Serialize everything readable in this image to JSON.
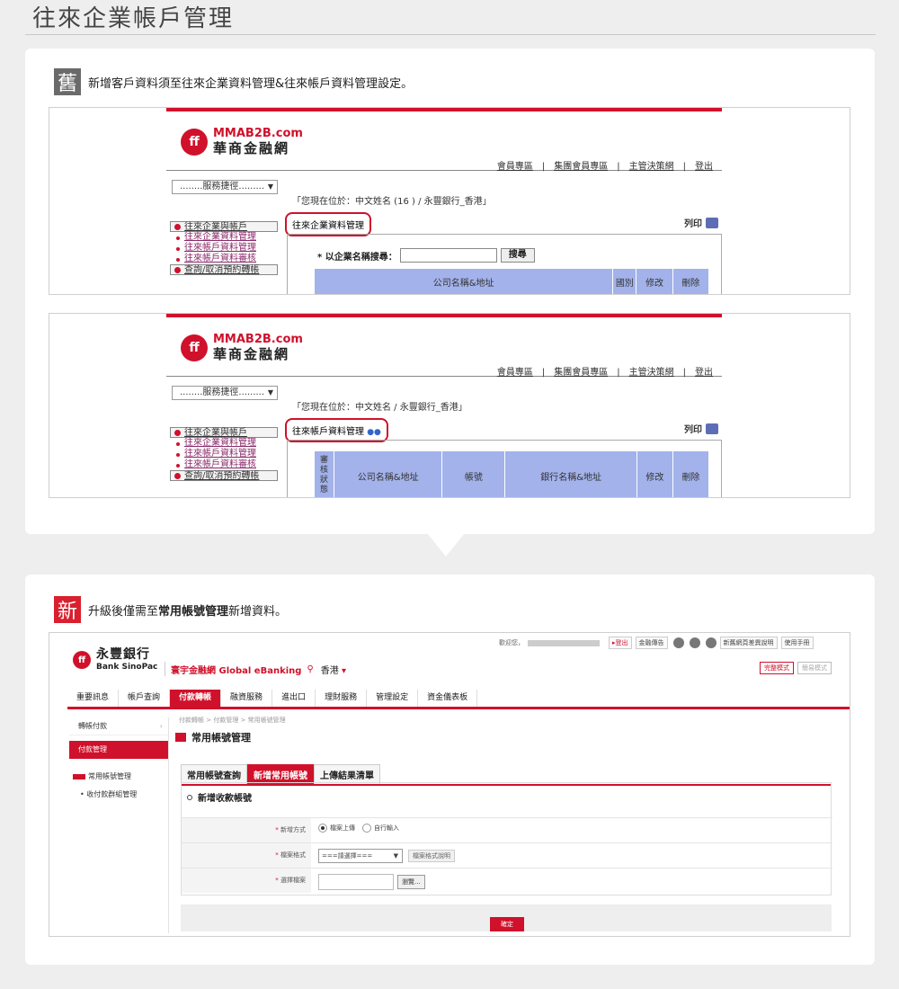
{
  "page_title": "往來企業帳戶管理",
  "old": {
    "badge": "舊",
    "note": "新增客戶資料須至往來企業資料管理&往來帳戶資料管理設定。",
    "brand_en": "MMAB2B.com",
    "brand_zh": "華商金融網",
    "logo_glyph": "ff",
    "top_links": [
      "會員專區",
      "集團會員專區",
      "主管決策網",
      "登出"
    ],
    "service_select": "........服務捷徑.........",
    "side_head1": "往來企業與帳戶",
    "side_items": [
      "往來企業資料管理",
      "往來帳戶資料管理",
      "往來帳戶資料審核"
    ],
    "side_head2": "查詢/取消預約轉帳",
    "print_label": "列印",
    "shot1": {
      "location": "「您現在位於：中文姓名 (16        ) / 永豐銀行_香港」",
      "section_title": "往來企業資料管理",
      "search_label": "* 以企業名稱搜尋：",
      "search_button": "搜尋",
      "columns": [
        "公司名稱&地址",
        "國別",
        "修改",
        "刪除"
      ]
    },
    "shot2": {
      "location": "「您現在位於：中文姓名            / 永豐銀行_香港」",
      "section_title": "往來帳戶資料管理",
      "columns": [
        "審核狀態",
        "公司名稱&地址",
        "帳號",
        "銀行名稱&地址",
        "修改",
        "刪除"
      ]
    }
  },
  "new": {
    "badge": "新",
    "note_prefix": "升級後僅需至",
    "note_bold": "常用帳號管理",
    "note_suffix": "新增資料。",
    "welcome": "歡迎您，",
    "top_links": [
      "▸登出",
      "金融傳告",
      "新舊網頁差異說明",
      "使用手冊"
    ],
    "bank_zh": "永豐銀行",
    "bank_en": "Bank SinoPac",
    "logo_glyph": "ff",
    "ebank": "寰宇金融網 Global eBanking",
    "region": "香港",
    "modes": [
      "完整模式",
      "簡易模式"
    ],
    "nav": [
      "重要訊息",
      "帳戶查詢",
      "付款轉帳",
      "融資服務",
      "進出口",
      "理財服務",
      "管理設定",
      "資金儀表板"
    ],
    "left_menu": [
      "轉帳付款",
      "付款管理",
      "常用帳號管理",
      "收付款群組管理"
    ],
    "breadcrumb": "付款轉帳 > 付款管理 > 常用帳號管理",
    "page_title": "常用帳號管理",
    "tabs": [
      "常用帳號查詢",
      "新增常用帳號",
      "上傳結果清單"
    ],
    "form_title": "新增收款帳號",
    "row1_label": "新增方式",
    "row1_opt1": "檔案上傳",
    "row1_opt2": "自行輸入",
    "row2_label": "檔案格式",
    "row2_select": "===請選擇===",
    "row2_button": "檔案格式說明",
    "row3_label": "選擇檔案",
    "row3_button": "瀏覽...",
    "ok": "確定"
  },
  "colors": {
    "brand_red": "#d0112b",
    "table_header": "#a3b2ea"
  }
}
